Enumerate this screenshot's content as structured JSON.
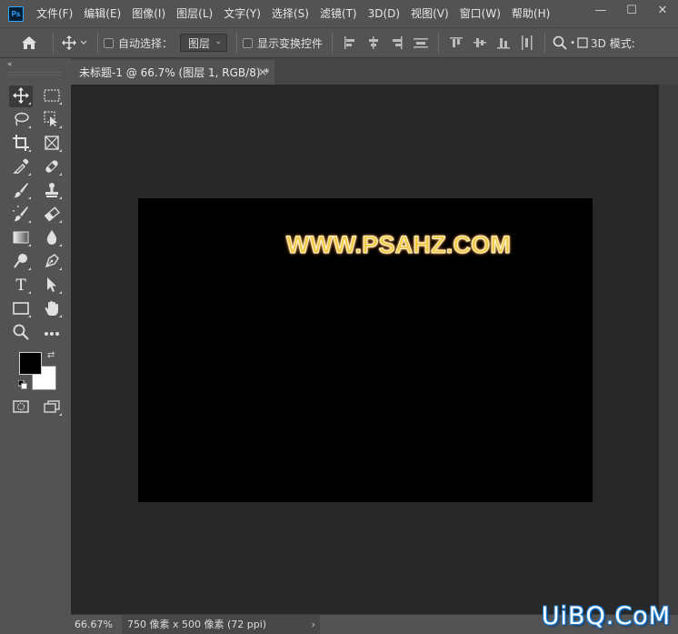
{
  "app": {
    "logo_text": "Ps"
  },
  "menu": [
    "文件(F)",
    "编辑(E)",
    "图像(I)",
    "图层(L)",
    "文字(Y)",
    "选择(S)",
    "滤镜(T)",
    "3D(D)",
    "视图(V)",
    "窗口(W)",
    "帮助(H)"
  ],
  "window_controls": {
    "minimize": "—",
    "restore": "☐",
    "close": "✕"
  },
  "options_bar": {
    "auto_select_label": "自动选择：",
    "auto_select_value": "图层",
    "show_transform_label": "显示变换控件",
    "mode_3d_label": "3D 模式:"
  },
  "document": {
    "tab_title": "未标题-1 @ 66.7% (图层 1, RGB/8) *",
    "close_glyph": "×",
    "canvas_text": "WWW.PSAHZ.COM"
  },
  "colors": {
    "foreground": "#000000",
    "background": "#ffffff",
    "canvas_bg": "#000000",
    "pasteboard": "#282828",
    "ui_panel": "#535353",
    "text_fill": "#f5c842"
  },
  "tools": [
    {
      "name": "move-tool",
      "icon": "move-icon"
    },
    {
      "name": "marquee-tool",
      "icon": "rect-marquee-icon"
    },
    {
      "name": "lasso-tool",
      "icon": "lasso-icon"
    },
    {
      "name": "object-select-tool",
      "icon": "object-select-icon"
    },
    {
      "name": "crop-tool",
      "icon": "crop-icon"
    },
    {
      "name": "frame-tool",
      "icon": "frame-icon"
    },
    {
      "name": "eyedropper-tool",
      "icon": "eyedropper-icon"
    },
    {
      "name": "healing-tool",
      "icon": "bandage-icon"
    },
    {
      "name": "brush-tool",
      "icon": "brush-icon"
    },
    {
      "name": "stamp-tool",
      "icon": "stamp-icon"
    },
    {
      "name": "history-brush-tool",
      "icon": "history-brush-icon"
    },
    {
      "name": "eraser-tool",
      "icon": "eraser-icon"
    },
    {
      "name": "gradient-tool",
      "icon": "gradient-icon"
    },
    {
      "name": "blur-tool",
      "icon": "drop-icon"
    },
    {
      "name": "dodge-tool",
      "icon": "dodge-icon"
    },
    {
      "name": "pen-tool",
      "icon": "pen-icon"
    },
    {
      "name": "type-tool",
      "icon": "type-icon"
    },
    {
      "name": "path-select-tool",
      "icon": "arrow-icon"
    },
    {
      "name": "shape-tool",
      "icon": "rectangle-icon"
    },
    {
      "name": "hand-tool",
      "icon": "hand-icon"
    },
    {
      "name": "zoom-tool",
      "icon": "zoom-icon"
    },
    {
      "name": "more-tools",
      "icon": "ellipsis-icon"
    }
  ],
  "status": {
    "zoom": "66.67%",
    "doc_info": "750 像素 x 500 像素 (72 ppi)",
    "arrow": "›"
  },
  "watermark": "UiBQ.CoM"
}
